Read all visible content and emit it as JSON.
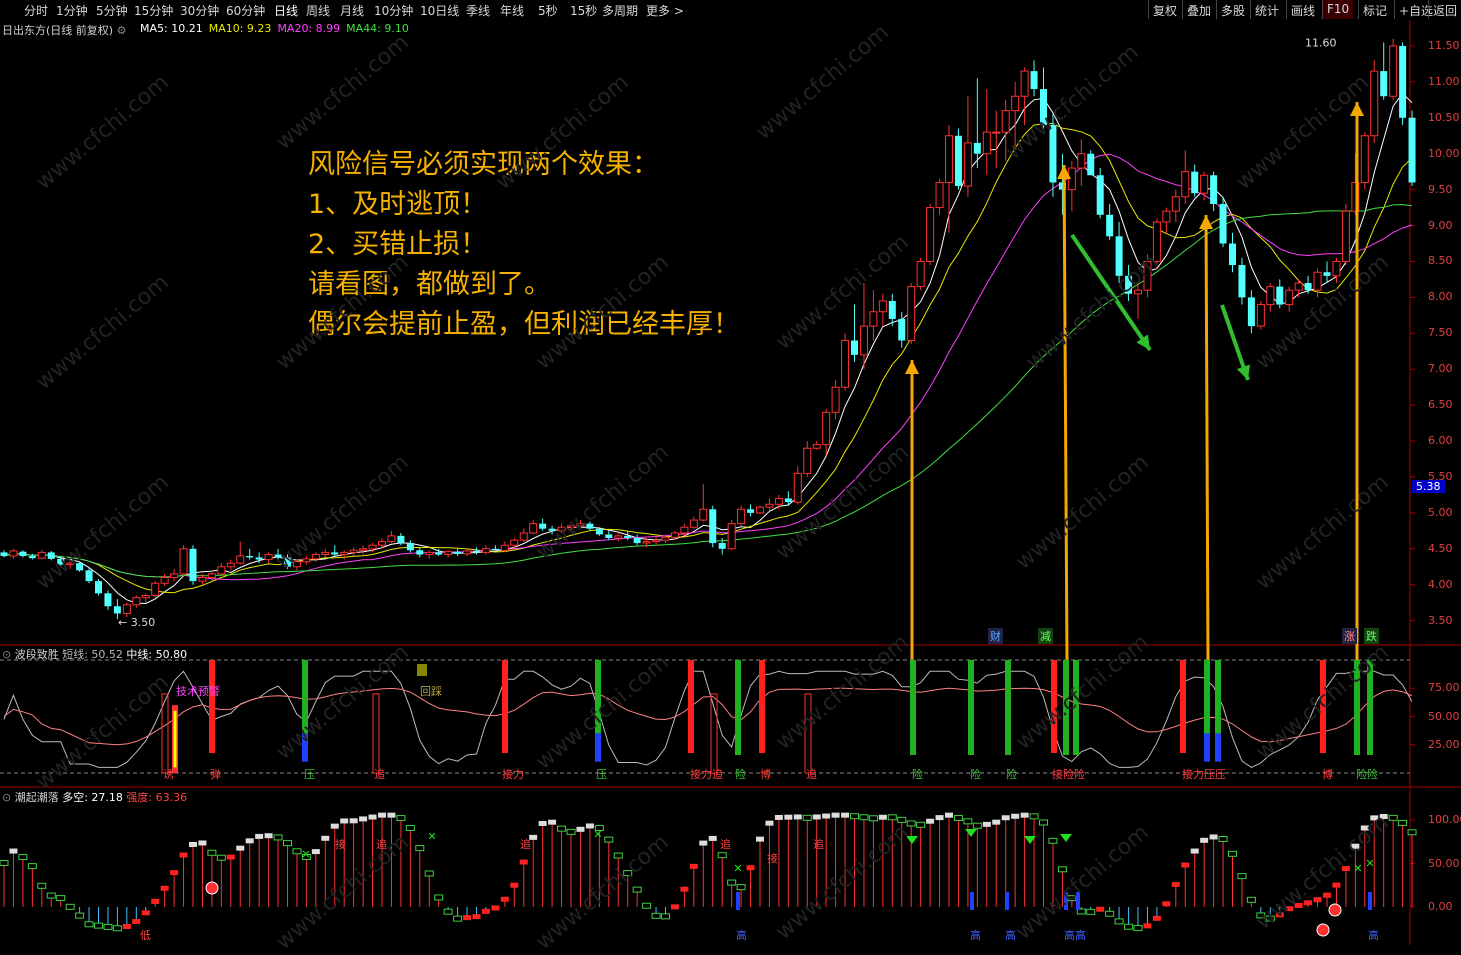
{
  "toolbar": {
    "periods": [
      "分时",
      "1分钟",
      "5分钟",
      "15分钟",
      "30分钟",
      "60分钟",
      "日线",
      "周线",
      "月线",
      "10分钟",
      "10日线",
      "季线",
      "年线",
      "5秒",
      "15秒",
      "多周期",
      "更多 >"
    ],
    "active_period": "日线",
    "right_buttons": [
      "复权",
      "叠加",
      "多股",
      "统计",
      "画线",
      "F10",
      "标记",
      "+自选",
      "返回"
    ]
  },
  "main_panel": {
    "stock": "日出东方(日线 前复权)",
    "ma": [
      {
        "label": "MA5: 10.21",
        "color": "#ffffff"
      },
      {
        "label": "MA10: 9.23",
        "color": "#e8e800"
      },
      {
        "label": "MA20: 8.99",
        "color": "#ff40ff"
      },
      {
        "label": "MA44: 9.10",
        "color": "#40e040"
      }
    ],
    "price_axis": [
      "11.50",
      "11.00",
      "10.50",
      "10.00",
      "9.50",
      "9.00",
      "8.50",
      "8.00",
      "7.50",
      "7.00",
      "6.50",
      "6.00",
      "5.50",
      "5.00",
      "4.50",
      "4.00",
      "3.50"
    ],
    "price_badge": "5.38",
    "high_label": "11.60",
    "low_label": "3.50",
    "event_labels": [
      "财",
      "减",
      "涨",
      "跌"
    ],
    "annotation": [
      "风险信号必须实现两个效果：",
      "1、及时逃顶！",
      "2、买错止损！",
      "请看图，都做到了。",
      "偶尔会提前止盈，但利润已经丰厚！"
    ]
  },
  "panel2": {
    "title": "波段致胜",
    "short_label": "短线: 50.52",
    "mid_label": "中线: 50.80",
    "axis": [
      "75.00",
      "50.00",
      "25.00"
    ],
    "top_notes": [
      "技术预警",
      "回踩"
    ],
    "signals": [
      "诱",
      "弹",
      "压",
      "追",
      "接力",
      "压",
      "接力追",
      "险",
      "博",
      "追",
      "险",
      "险",
      "险",
      "接险险",
      "接力压压",
      "博",
      "险险"
    ]
  },
  "panel3": {
    "title": "潮起潮落",
    "duokong_label": "多空: 27.18",
    "strength_label": "强度: 63.36",
    "axis": [
      "100.00",
      "50.00",
      "0.00"
    ],
    "top_notes": [
      "接",
      "追",
      "追",
      "追",
      "接",
      "追"
    ],
    "bottom_notes": [
      "低",
      "高",
      "高",
      "高",
      "高高",
      "高"
    ]
  },
  "watermark": "www.cfchi.com",
  "chart_data": {
    "type": "candlestick",
    "ylim": [
      3.3,
      11.75
    ],
    "ohlc": [
      [
        4.45,
        4.48,
        4.38,
        4.4
      ],
      [
        4.4,
        4.5,
        4.36,
        4.47
      ],
      [
        4.46,
        4.48,
        4.38,
        4.4
      ],
      [
        4.4,
        4.43,
        4.35,
        4.37
      ],
      [
        4.37,
        4.48,
        4.35,
        4.45
      ],
      [
        4.45,
        4.47,
        4.34,
        4.36
      ],
      [
        4.36,
        4.4,
        4.26,
        4.28
      ],
      [
        4.28,
        4.35,
        4.22,
        4.3
      ],
      [
        4.3,
        4.32,
        4.18,
        4.2
      ],
      [
        4.2,
        4.23,
        4.02,
        4.05
      ],
      [
        4.05,
        4.08,
        3.85,
        3.88
      ],
      [
        3.88,
        3.92,
        3.65,
        3.7
      ],
      [
        3.7,
        3.8,
        3.52,
        3.6
      ],
      [
        3.6,
        3.75,
        3.55,
        3.72
      ],
      [
        3.72,
        3.85,
        3.68,
        3.82
      ],
      [
        3.82,
        3.88,
        3.75,
        3.85
      ],
      [
        3.85,
        4.05,
        3.82,
        4.02
      ],
      [
        4.02,
        4.15,
        3.98,
        4.1
      ],
      [
        4.1,
        4.22,
        4.05,
        4.15
      ],
      [
        4.15,
        4.55,
        4.12,
        4.5
      ],
      [
        4.5,
        4.55,
        4.0,
        4.05
      ],
      [
        4.05,
        4.15,
        4.0,
        4.1
      ],
      [
        4.1,
        4.2,
        4.05,
        4.15
      ],
      [
        4.15,
        4.3,
        4.12,
        4.25
      ],
      [
        4.25,
        4.35,
        4.2,
        4.3
      ],
      [
        4.3,
        4.6,
        4.28,
        4.4
      ],
      [
        4.4,
        4.5,
        4.35,
        4.38
      ],
      [
        4.38,
        4.45,
        4.3,
        4.35
      ],
      [
        4.35,
        4.45,
        4.3,
        4.42
      ],
      [
        4.42,
        4.5,
        4.35,
        4.38
      ],
      [
        4.38,
        4.42,
        4.22,
        4.25
      ],
      [
        4.25,
        4.35,
        4.2,
        4.32
      ],
      [
        4.32,
        4.4,
        4.28,
        4.36
      ],
      [
        4.36,
        4.45,
        4.32,
        4.42
      ],
      [
        4.42,
        4.5,
        4.38,
        4.45
      ],
      [
        4.45,
        4.55,
        4.4,
        4.42
      ],
      [
        4.42,
        4.48,
        4.35,
        4.45
      ],
      [
        4.45,
        4.52,
        4.4,
        4.48
      ],
      [
        4.48,
        4.55,
        4.42,
        4.5
      ],
      [
        4.5,
        4.58,
        4.45,
        4.55
      ],
      [
        4.55,
        4.65,
        4.5,
        4.6
      ],
      [
        4.6,
        4.75,
        4.58,
        4.68
      ],
      [
        4.68,
        4.72,
        4.55,
        4.58
      ],
      [
        4.58,
        4.62,
        4.45,
        4.48
      ],
      [
        4.48,
        4.52,
        4.38,
        4.42
      ],
      [
        4.42,
        4.48,
        4.36,
        4.45
      ],
      [
        4.45,
        4.5,
        4.4,
        4.42
      ],
      [
        4.42,
        4.48,
        4.38,
        4.46
      ],
      [
        4.46,
        4.5,
        4.4,
        4.43
      ],
      [
        4.43,
        4.5,
        4.4,
        4.47
      ],
      [
        4.47,
        4.52,
        4.42,
        4.45
      ],
      [
        4.45,
        4.55,
        4.42,
        4.5
      ],
      [
        4.5,
        4.55,
        4.45,
        4.48
      ],
      [
        4.48,
        4.6,
        4.45,
        4.55
      ],
      [
        4.55,
        4.65,
        4.5,
        4.62
      ],
      [
        4.62,
        4.78,
        4.6,
        4.72
      ],
      [
        4.72,
        4.9,
        4.7,
        4.85
      ],
      [
        4.85,
        4.92,
        4.75,
        4.78
      ],
      [
        4.78,
        4.82,
        4.7,
        4.75
      ],
      [
        4.75,
        4.85,
        4.72,
        4.8
      ],
      [
        4.8,
        4.88,
        4.75,
        4.82
      ],
      [
        4.82,
        4.9,
        4.78,
        4.85
      ],
      [
        4.85,
        4.88,
        4.75,
        4.78
      ],
      [
        4.78,
        4.8,
        4.68,
        4.7
      ],
      [
        4.7,
        4.75,
        4.62,
        4.65
      ],
      [
        4.65,
        4.72,
        4.6,
        4.68
      ],
      [
        4.68,
        4.75,
        4.62,
        4.65
      ],
      [
        4.65,
        4.7,
        4.55,
        4.58
      ],
      [
        4.58,
        4.65,
        4.52,
        4.6
      ],
      [
        4.6,
        4.68,
        4.55,
        4.62
      ],
      [
        4.62,
        4.7,
        4.58,
        4.66
      ],
      [
        4.66,
        4.75,
        4.62,
        4.72
      ],
      [
        4.72,
        4.85,
        4.68,
        4.8
      ],
      [
        4.8,
        4.95,
        4.78,
        4.9
      ],
      [
        4.9,
        5.4,
        4.88,
        5.05
      ],
      [
        5.05,
        5.1,
        4.52,
        4.58
      ],
      [
        4.58,
        4.65,
        4.42,
        4.5
      ],
      [
        4.5,
        4.9,
        4.48,
        4.85
      ],
      [
        4.85,
        5.1,
        4.82,
        5.05
      ],
      [
        5.05,
        5.12,
        4.95,
        5.0
      ],
      [
        5.0,
        5.1,
        4.98,
        5.08
      ],
      [
        5.08,
        5.2,
        5.02,
        5.12
      ],
      [
        5.12,
        5.25,
        5.05,
        5.2
      ],
      [
        5.2,
        5.3,
        5.1,
        5.15
      ],
      [
        5.15,
        5.65,
        5.12,
        5.55
      ],
      [
        5.55,
        6.0,
        5.5,
        5.9
      ],
      [
        5.9,
        6.0,
        5.88,
        5.95
      ],
      [
        5.95,
        6.45,
        5.8,
        6.4
      ],
      [
        6.4,
        6.85,
        6.3,
        6.75
      ],
      [
        6.75,
        7.5,
        6.7,
        7.4
      ],
      [
        7.4,
        7.9,
        7.1,
        7.2
      ],
      [
        7.2,
        8.2,
        7.0,
        7.6
      ],
      [
        7.6,
        8.1,
        7.4,
        7.8
      ],
      [
        7.8,
        8.05,
        7.6,
        7.95
      ],
      [
        7.95,
        8.05,
        7.6,
        7.7
      ],
      [
        7.7,
        7.8,
        7.3,
        7.4
      ],
      [
        7.4,
        8.2,
        7.35,
        8.15
      ],
      [
        8.15,
        8.55,
        8.1,
        8.5
      ],
      [
        8.5,
        9.3,
        8.45,
        9.25
      ],
      [
        9.25,
        9.65,
        9.15,
        9.6
      ],
      [
        9.6,
        10.4,
        8.9,
        10.25
      ],
      [
        10.25,
        10.35,
        9.5,
        9.55
      ],
      [
        9.55,
        10.8,
        9.4,
        10.15
      ],
      [
        10.15,
        11.05,
        9.8,
        10.0
      ],
      [
        10.0,
        10.9,
        9.7,
        10.3
      ],
      [
        10.3,
        10.6,
        9.8,
        10.3
      ],
      [
        10.3,
        10.75,
        9.9,
        10.6
      ],
      [
        10.6,
        11.0,
        10.1,
        10.8
      ],
      [
        10.8,
        11.2,
        10.4,
        11.15
      ],
      [
        11.15,
        11.3,
        10.8,
        10.9
      ],
      [
        10.9,
        11.2,
        10.3,
        10.4
      ],
      [
        10.4,
        10.55,
        9.4,
        9.6
      ],
      [
        9.6,
        10.0,
        9.15,
        9.5
      ],
      [
        9.5,
        9.9,
        9.2,
        9.8
      ],
      [
        9.8,
        10.2,
        9.55,
        10.0
      ],
      [
        10.0,
        10.05,
        9.7,
        9.7
      ],
      [
        9.7,
        9.8,
        9.1,
        9.15
      ],
      [
        9.15,
        9.3,
        8.8,
        8.85
      ],
      [
        8.85,
        9.05,
        8.2,
        8.3
      ],
      [
        8.3,
        8.45,
        7.95,
        8.05
      ],
      [
        8.05,
        8.2,
        7.7,
        8.1
      ],
      [
        8.1,
        8.6,
        8.0,
        8.5
      ],
      [
        8.5,
        9.1,
        8.4,
        9.05
      ],
      [
        9.05,
        9.25,
        8.9,
        9.2
      ],
      [
        9.2,
        9.5,
        9.05,
        9.4
      ],
      [
        9.4,
        10.05,
        9.3,
        9.75
      ],
      [
        9.75,
        9.85,
        9.4,
        9.45
      ],
      [
        9.45,
        9.75,
        9.35,
        9.7
      ],
      [
        9.7,
        9.75,
        9.2,
        9.3
      ],
      [
        9.3,
        9.4,
        8.7,
        8.75
      ],
      [
        8.75,
        8.9,
        8.35,
        8.45
      ],
      [
        8.45,
        8.55,
        7.9,
        8.0
      ],
      [
        8.0,
        8.1,
        7.5,
        7.6
      ],
      [
        7.6,
        7.95,
        7.55,
        7.9
      ],
      [
        7.9,
        8.2,
        7.8,
        8.15
      ],
      [
        8.15,
        8.25,
        7.85,
        7.9
      ],
      [
        7.9,
        8.15,
        7.8,
        8.1
      ],
      [
        8.1,
        8.25,
        8.0,
        8.2
      ],
      [
        8.2,
        8.3,
        8.05,
        8.1
      ],
      [
        8.1,
        8.4,
        8.0,
        8.35
      ],
      [
        8.35,
        8.5,
        8.2,
        8.3
      ],
      [
        8.3,
        8.55,
        8.2,
        8.5
      ],
      [
        8.5,
        9.3,
        8.45,
        9.2
      ],
      [
        9.2,
        10.0,
        9.15,
        9.6
      ],
      [
        9.6,
        10.3,
        9.5,
        10.25
      ],
      [
        10.25,
        11.3,
        10.15,
        11.15
      ],
      [
        11.15,
        11.55,
        10.75,
        10.8
      ],
      [
        10.8,
        11.6,
        10.75,
        11.5
      ],
      [
        11.5,
        11.55,
        10.4,
        10.5
      ],
      [
        10.5,
        10.6,
        9.55,
        9.6
      ]
    ]
  }
}
